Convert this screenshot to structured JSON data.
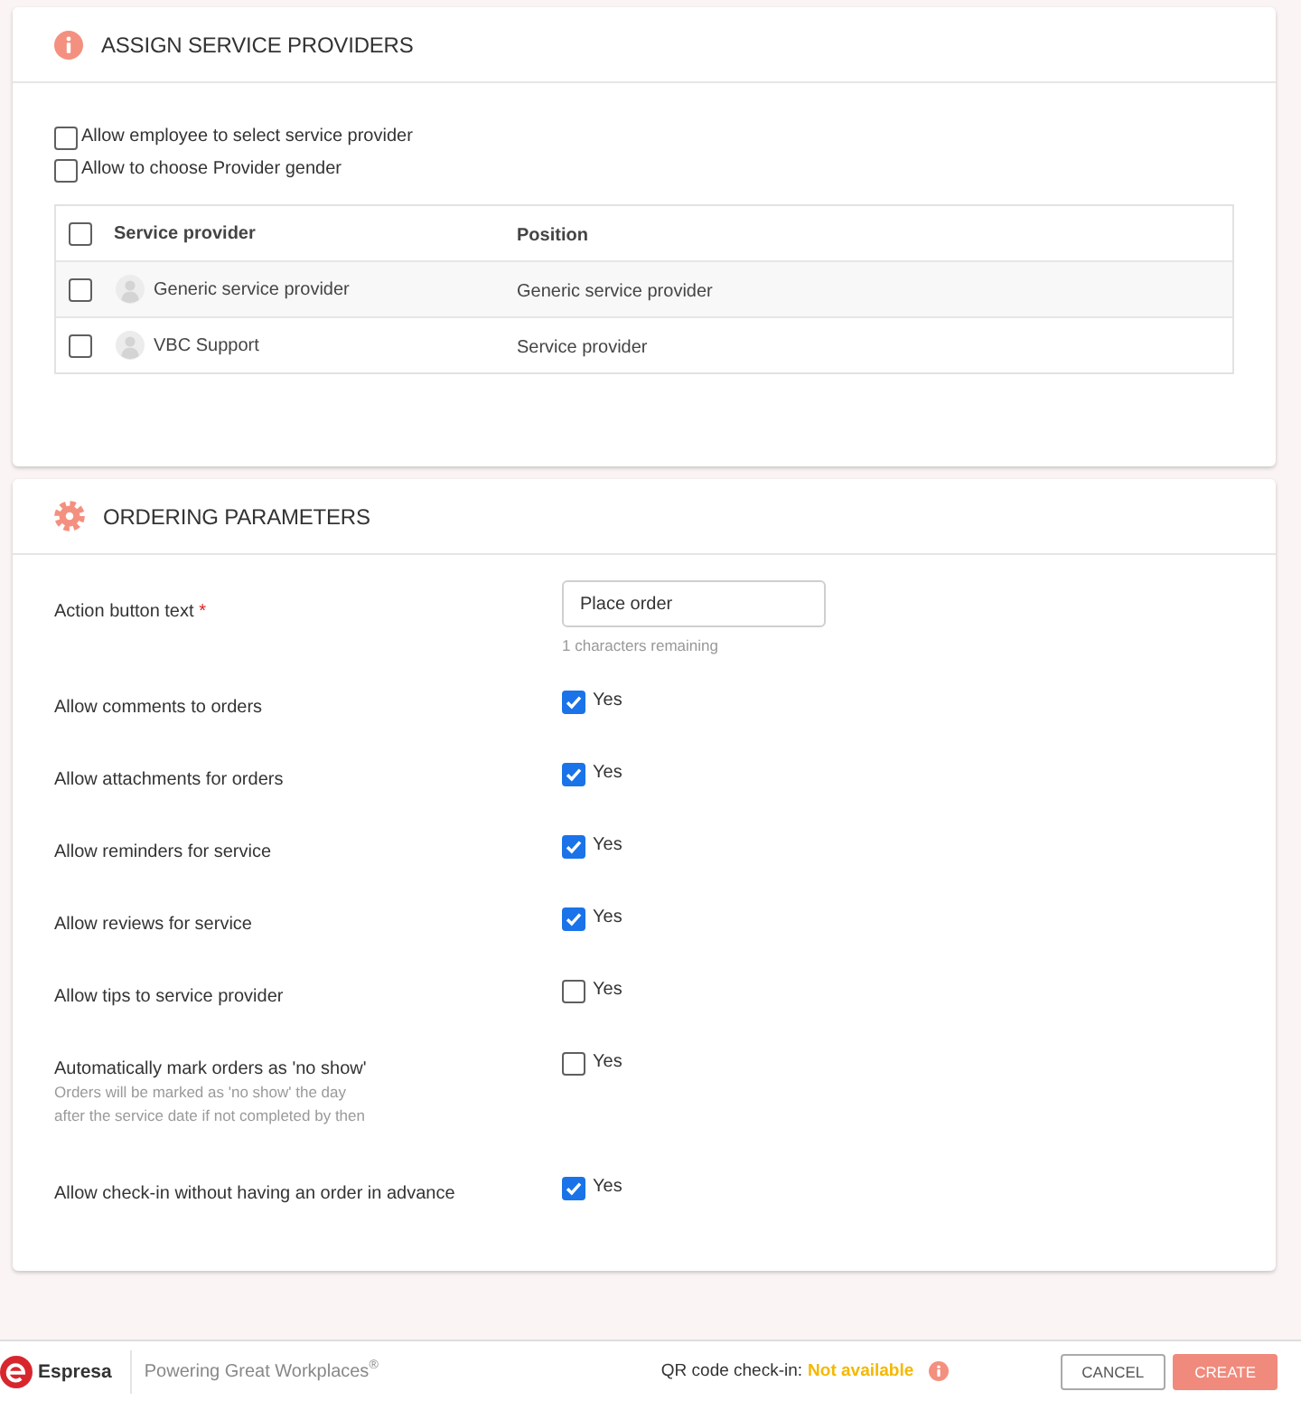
{
  "sections": [
    {
      "kind": "providers",
      "title": "ASSIGN SERVICE PROVIDERS",
      "options": [
        {
          "label": "Allow employee to select service provider",
          "checked": false
        },
        {
          "label": "Allow to choose Provider gender",
          "checked": false
        }
      ],
      "table": {
        "select_all_checked": false,
        "columns": [
          "Service provider",
          "Position"
        ],
        "rows": [
          {
            "checked": false,
            "name": "Generic service provider",
            "position": "Generic service provider"
          },
          {
            "checked": false,
            "name": "VBC Support",
            "position": "Service provider"
          }
        ]
      }
    },
    {
      "kind": "ordering",
      "title": "ORDERING PARAMETERS",
      "field": {
        "label": "Action button text",
        "required_mark": "*",
        "value": "Place order",
        "hint": "1 characters remaining"
      },
      "settings": [
        {
          "label": "Allow comments to orders",
          "checked": true,
          "option_label": "Yes"
        },
        {
          "label": "Allow attachments for orders",
          "checked": true,
          "option_label": "Yes"
        },
        {
          "label": "Allow reminders for service",
          "checked": true,
          "option_label": "Yes"
        },
        {
          "label": "Allow reviews for service",
          "checked": true,
          "option_label": "Yes"
        },
        {
          "label": "Allow tips to service provider",
          "checked": false,
          "option_label": "Yes"
        },
        {
          "label": "Automatically mark orders as 'no show'",
          "description": "Orders will be marked as 'no show' the day\nafter the service date if not completed by then",
          "checked": false,
          "option_label": "Yes"
        },
        {
          "label": "Allow check-in without having an order in advance",
          "checked": true,
          "option_label": "Yes"
        }
      ]
    }
  ],
  "footer": {
    "brand": "Espresa",
    "tagline": "Powering Great Workplaces$^{®}$",
    "qr_label": "QR code check-in:",
    "qr_status": "Not available",
    "buttons": [
      {
        "label": "CANCEL",
        "kind": "secondary"
      },
      {
        "label": "CREATE",
        "kind": "primary"
      }
    ]
  }
}
